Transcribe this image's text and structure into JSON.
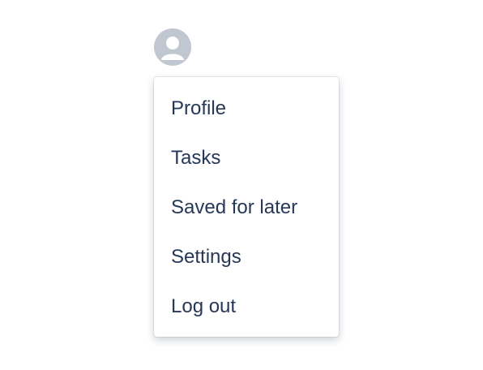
{
  "avatar": {
    "icon": "user-avatar-icon",
    "background_color": "#C1C7D0",
    "glyph_color": "#FFFFFF"
  },
  "menu": {
    "text_color": "#253858",
    "items": [
      {
        "label": "Profile"
      },
      {
        "label": "Tasks"
      },
      {
        "label": "Saved for later"
      },
      {
        "label": "Settings"
      },
      {
        "label": "Log out"
      }
    ]
  }
}
